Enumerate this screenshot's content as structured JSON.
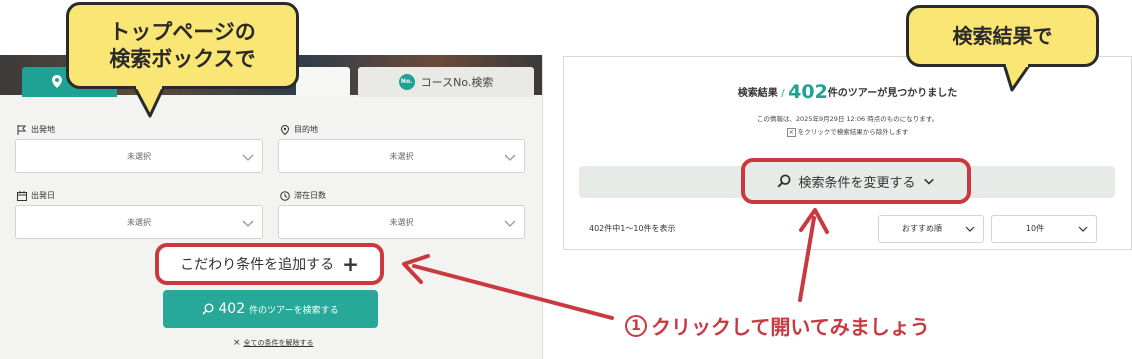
{
  "callouts": {
    "left_line1": "トップページの",
    "left_line2": "検索ボックスで",
    "right": "検索結果で"
  },
  "top_page": {
    "tab_course_badge": "No.",
    "tab_course_label": "コースNo.検索",
    "fields": {
      "departure": {
        "label": "出発地",
        "value": "未選択"
      },
      "destination": {
        "label": "目的地",
        "value": "未選択"
      },
      "departure_date": {
        "label": "出発日",
        "value": "未選択"
      },
      "stay_days": {
        "label": "滞在日数",
        "value": "未選択"
      }
    },
    "add_conditions_label": "こだわり条件を追加する",
    "search_button": {
      "count": "402",
      "suffix": "件のツアーを検索する"
    },
    "clear_all_label": "全ての条件を解除する"
  },
  "results_page": {
    "heading_prefix": "検索結果",
    "heading_slash": "/",
    "count": "402",
    "heading_suffix": "件のツアーが見つかりました",
    "info_text": "この情報は、2025年9月29日 12:06 時点のものになります。",
    "exclude_text": "をクリックで検索結果から除外します",
    "change_conditions_label": "検索条件を変更する",
    "result_range": "402件中1〜10件を表示",
    "sort_value": "おすすめ順",
    "per_page_value": "10件"
  },
  "instruction": {
    "number": "1",
    "text": "クリックして開いてみましょう"
  },
  "colors": {
    "accent_teal": "#1fa294",
    "highlight_red": "#c9393f",
    "callout_yellow": "#f9e675"
  }
}
